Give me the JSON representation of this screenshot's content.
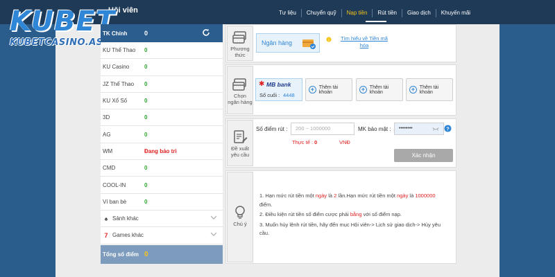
{
  "header": {
    "member_title": "Hội viên",
    "nav": [
      {
        "label": "Tư liệu"
      },
      {
        "label": "Chuyển quỹ"
      },
      {
        "label": "Nạp tiền"
      },
      {
        "label": "Rút tiền"
      },
      {
        "label": "Giao dịch"
      },
      {
        "label": "Khuyến mãi"
      }
    ]
  },
  "logo": {
    "big": "KUBET",
    "small": "KUBETCASINO.ASIA"
  },
  "left": {
    "main_account": {
      "label": "TK Chính",
      "value": "0"
    },
    "rows": [
      {
        "name": "KU Thể Thao",
        "value": "0"
      },
      {
        "name": "KU Casino",
        "value": "0"
      },
      {
        "name": "JZ Thể Thao",
        "value": "0"
      },
      {
        "name": "KU Xổ Số",
        "value": "0"
      },
      {
        "name": "3D",
        "value": "0"
      },
      {
        "name": "AG",
        "value": "0"
      },
      {
        "name": "WM",
        "value": "Đang bảo trì"
      },
      {
        "name": "CMD",
        "value": "0"
      },
      {
        "name": "COOL-IN",
        "value": "0"
      },
      {
        "name": "Ví ban bè",
        "value": "0"
      }
    ],
    "lobby": {
      "label": "Sảnh khác"
    },
    "games": {
      "label": "Games khác"
    },
    "total": {
      "label": "Tổng số điểm",
      "value": "0"
    }
  },
  "method": {
    "caption_1": "Phương",
    "caption_2": "thức",
    "option": "Ngân hàng",
    "guide_1": "Tìm hiểu về Tiền mã",
    "guide_2": "hóa"
  },
  "bank": {
    "caption_1": "Chọn",
    "caption_2": "ngân hàng",
    "selected": {
      "name": "MB bank",
      "suffix_label": "Số cuối :",
      "suffix_value": "4448"
    },
    "add_label": "Thêm tài khoản"
  },
  "request": {
    "caption_1": "Đề xuất",
    "caption_2": "yêu cầu",
    "points_label": "Số điểm rút :",
    "points_placeholder": "200 ~ 1000000",
    "actual_label": "Thực tế :",
    "actual_value": "0",
    "currency": "VNĐ",
    "pin_label": "MK bảo mật :",
    "pin_value": "••••••••",
    "confirm": "Xác nhận"
  },
  "notes": {
    "caption": "Chú ý",
    "n1_a": "Hạn mức rút tiền một ",
    "n1_b": "ngày",
    "n1_c": " là ",
    "n1_d": "2",
    "n1_e": " lần.Hạn mức rút tiền một ",
    "n1_f": "ngày",
    "n1_g": " là ",
    "n1_h": "1000000",
    "n1_i": " điểm.",
    "n2_a": "Điều kiện rút tiền số điểm cược phải ",
    "n2_b": "bằng",
    "n2_c": " với số điểm nạp.",
    "n3": "Muốn hủy lệnh rút tiền, hãy đến mục Hội viên-> Lịch sử giao dịch-> Hủy yêu cầu."
  },
  "colors": {
    "header": "#1f3a57",
    "accent_blue": "#2b5d8e",
    "green": "#2aa52a",
    "red": "#e02020",
    "yellow": "#f5c518"
  }
}
